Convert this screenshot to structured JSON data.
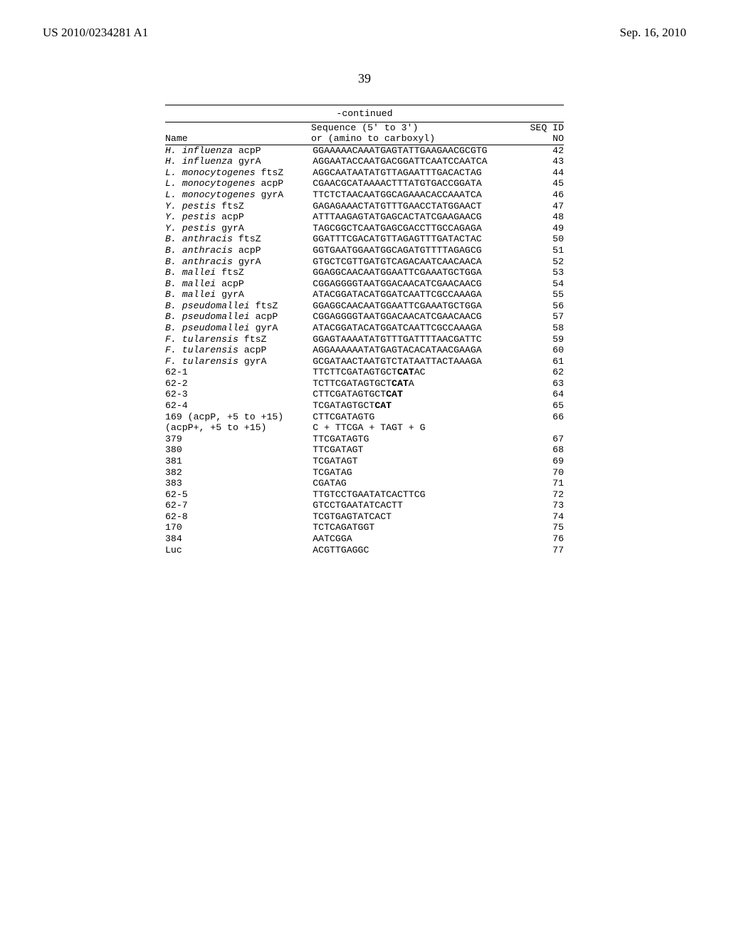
{
  "header": {
    "pub_number": "US 2010/0234281 A1",
    "pub_date": "Sep. 16, 2010"
  },
  "page_number": "39",
  "table": {
    "continued_label": "-continued",
    "columns": {
      "name_label_1": "Name",
      "seq_label_1": "Sequence (5' to 3')",
      "seq_label_2": "or (amino to carboxyl)",
      "id_label_1": "SEQ ID",
      "id_label_2": "NO"
    },
    "rows": [
      {
        "name_italic": "H. influenza",
        "name_rest": " acpP",
        "seq": "GGAAAAACAAATGAGTATTGAAGAACGCGTG",
        "id": "42"
      },
      {
        "name_italic": "H. influenza",
        "name_rest": " gyrA",
        "seq": "AGGAATACCAATGACGGATTCAATCCAATCA",
        "id": "43"
      },
      {
        "name_italic": "L. monocytogenes",
        "name_rest": " ftsZ",
        "seq": "AGGCAATAATATGTTAGAATTTGACACTAG",
        "id": "44"
      },
      {
        "name_italic": "L. monocytogenes",
        "name_rest": " acpP",
        "seq": "CGAACGCATAAAACTTTATGTGACCGGATA",
        "id": "45"
      },
      {
        "name_italic": "L. monocytogenes",
        "name_rest": " gyrA",
        "seq": "TTCTCTAACAATGGCAGAAACACCAAATCA",
        "id": "46"
      },
      {
        "name_italic": "Y. pestis",
        "name_rest": " ftsZ",
        "seq": "GAGAGAAACTATGTTTGAACCTATGGAACT",
        "id": "47"
      },
      {
        "name_italic": "Y. pestis",
        "name_rest": " acpP",
        "seq": "ATTTAAGAGTATGAGCACTATCGAAGAACG",
        "id": "48"
      },
      {
        "name_italic": "Y. pestis",
        "name_rest": " gyrA",
        "seq": "TAGCGGCTCAATGAGCGACCTTGCCAGAGA",
        "id": "49"
      },
      {
        "name_italic": "B. anthracis",
        "name_rest": " ftsZ",
        "seq": "GGATTTCGACATGTTAGAGTTTGATACTAC",
        "id": "50"
      },
      {
        "name_italic": "B. anthracis",
        "name_rest": " acpP",
        "seq": "GGTGAATGGAATGGCAGATGTTTTAGAGCG",
        "id": "51"
      },
      {
        "name_italic": "B. anthracis",
        "name_rest": " gyrA",
        "seq": "GTGCTCGTTGATGTCAGACAATCAACAACA",
        "id": "52"
      },
      {
        "name_italic": "B. mallei",
        "name_rest": " ftsZ",
        "seq": "GGAGGCAACAATGGAATTCGAAATGCTGGA",
        "id": "53"
      },
      {
        "name_italic": "B. mallei",
        "name_rest": " acpP",
        "seq": "CGGAGGGGTAATGGACAACATCGAACAACG",
        "id": "54"
      },
      {
        "name_italic": "B. mallei",
        "name_rest": " gyrA",
        "seq": "ATACGGATACATGGATCAATTCGCCAAAGA",
        "id": "55"
      },
      {
        "name_italic": "B. pseudomallei",
        "name_rest": " ftsZ",
        "seq": "GGAGGCAACAATGGAATTCGAAATGCTGGA",
        "id": "56"
      },
      {
        "name_italic": "B. pseudomallei",
        "name_rest": " acpP",
        "seq": "CGGAGGGGTAATGGACAACATCGAACAACG",
        "id": "57"
      },
      {
        "name_italic": "B. pseudomallei",
        "name_rest": " gyrA",
        "seq": "ATACGGATACATGGATCAATTCGCCAAAGA",
        "id": "58"
      },
      {
        "name_italic": "F. tularensis",
        "name_rest": " ftsZ",
        "seq": "GGAGTAAAATATGTTTGATTTTAACGATTC",
        "id": "59"
      },
      {
        "name_italic": "F. tularensis",
        "name_rest": " acpP",
        "seq": "AGGAAAAAATATGAGTACACATAACGAAGA",
        "id": "60"
      },
      {
        "name_italic": "F. tularensis",
        "name_rest": " gyrA",
        "seq": "GCGATAACTAATGTCTATAATTACTAAAGA",
        "id": "61"
      },
      {
        "name_plain": "62-1",
        "seq_pre": "TTCTTCGATAGTGCT",
        "seq_bold": "CAT",
        "seq_post": "AC",
        "id": "62"
      },
      {
        "name_plain": "62-2",
        "seq_pre": "TCTTCGATAGTGCT",
        "seq_bold": "CAT",
        "seq_post": "A",
        "id": "63"
      },
      {
        "name_plain": "62-3",
        "seq_pre": "CTTCGATAGTGCT",
        "seq_bold": "CAT",
        "seq_post": "",
        "id": "64"
      },
      {
        "name_plain": "62-4",
        "seq_pre": "TCGATAGTGCT",
        "seq_bold": "CAT",
        "seq_post": "",
        "id": "65"
      },
      {
        "name_plain": "169 (acpP, +5 to +15)",
        "seq": "CTTCGATAGTG",
        "id": "66"
      },
      {
        "name_plain": "(acpP+, +5 to +15)",
        "seq": "C + TTCGA + TAGT + G",
        "id": ""
      },
      {
        "name_plain": "379",
        "seq": "TTCGATAGTG",
        "id": "67"
      },
      {
        "name_plain": "380",
        "seq": "TTCGATAGT",
        "id": "68"
      },
      {
        "name_plain": "381",
        "seq": "TCGATAGT",
        "id": "69"
      },
      {
        "name_plain": "382",
        "seq": "TCGATAG",
        "id": "70"
      },
      {
        "name_plain": "383",
        "seq": "CGATAG",
        "id": "71"
      },
      {
        "name_plain": "62-5",
        "seq": "TTGTCCTGAATATCACTTCG",
        "id": "72"
      },
      {
        "name_plain": "62-7",
        "seq": "GTCCTGAATATCACTT",
        "id": "73"
      },
      {
        "name_plain": "62-8",
        "seq": "TCGTGAGTATCACT",
        "id": "74"
      },
      {
        "name_plain": "170",
        "seq": "TCTCAGATGGT",
        "id": "75"
      },
      {
        "name_plain": "384",
        "seq": "AATCGGA",
        "id": "76"
      },
      {
        "name_plain": "Luc",
        "seq": "ACGTTGAGGC",
        "id": "77"
      }
    ]
  }
}
